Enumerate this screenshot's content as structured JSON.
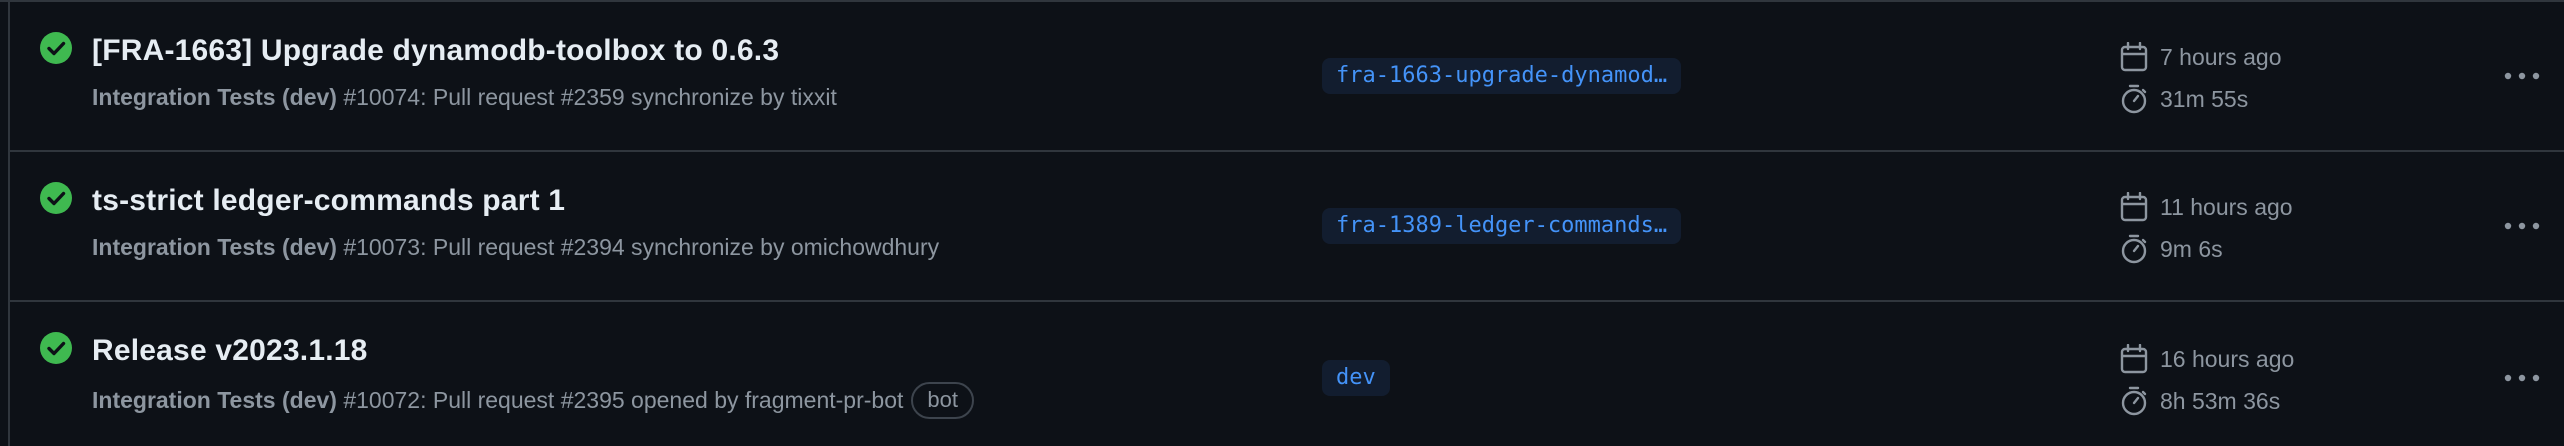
{
  "runs": [
    {
      "title": "[FRA-1663] Upgrade dynamodb-toolbox to 0.6.3",
      "workflow": "Integration Tests (dev)",
      "details": " #10074: Pull request #2359 synchronize by tixxit",
      "branch": "fra-1663-upgrade-dynamod…",
      "created": "7 hours ago",
      "duration": "31m 55s",
      "status": "success",
      "status_icon": "check-circle-icon"
    },
    {
      "title": "ts-strict ledger-commands part 1",
      "workflow": "Integration Tests (dev)",
      "details": " #10073: Pull request #2394 synchronize by omichowdhury",
      "branch": "fra-1389-ledger-commands…",
      "created": "11 hours ago",
      "duration": "9m 6s",
      "status": "success",
      "status_icon": "check-circle-icon"
    },
    {
      "title": "Release v2023.1.18",
      "workflow": "Integration Tests (dev)",
      "details": " #10072: Pull request #2395 opened by fragment-pr-bot",
      "badge": "bot",
      "branch": "dev",
      "created": "16 hours ago",
      "duration": "8h 53m 36s",
      "status": "success",
      "status_icon": "check-circle-icon"
    }
  ],
  "colors": {
    "background": "#0d1117",
    "border": "#30363d",
    "success": "#3fb950",
    "branch_text": "#4493f8",
    "branch_bg": "#121d2f",
    "muted": "#8d96a0"
  }
}
